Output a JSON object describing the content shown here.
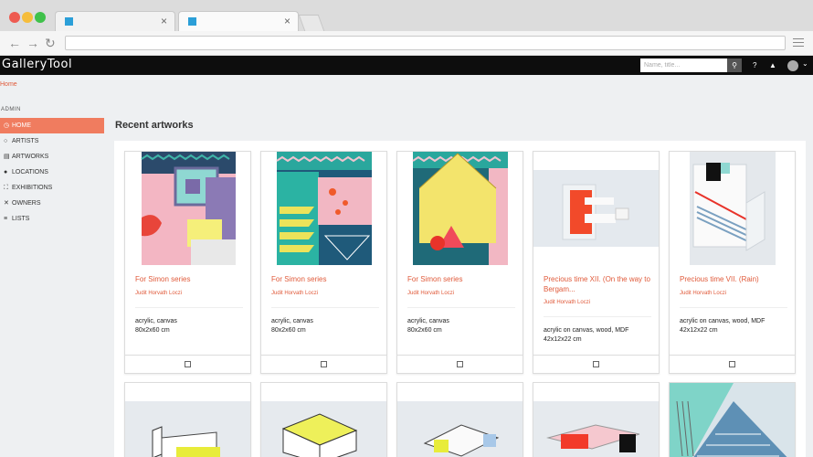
{
  "app": {
    "brand": "GalleryTool",
    "search_placeholder": "Name, title...",
    "search_icon": "search-icon"
  },
  "breadcrumb": {
    "home": "Home"
  },
  "sidebar": {
    "section": "ADMIN",
    "items": [
      {
        "label": "HOME",
        "icon": "clock-icon",
        "glyph": "◷",
        "active": true
      },
      {
        "label": "ARTISTS",
        "icon": "circle-icon",
        "glyph": "○",
        "active": false
      },
      {
        "label": "ARTWORKS",
        "icon": "images-icon",
        "glyph": "▤",
        "active": false
      },
      {
        "label": "LOCATIONS",
        "icon": "map-marker-icon",
        "glyph": "●",
        "active": false
      },
      {
        "label": "EXHIBITIONS",
        "icon": "expand-icon",
        "glyph": "⛶",
        "active": false
      },
      {
        "label": "OWNERS",
        "icon": "close-icon",
        "glyph": "✕",
        "active": false
      },
      {
        "label": "LISTS",
        "icon": "list-icon",
        "glyph": "≡",
        "active": false
      }
    ]
  },
  "main": {
    "title": "Recent artworks",
    "cards": [
      {
        "title": "For Simon series",
        "artist": "Judit Horvath Loczi",
        "medium": "acrylic, canvas",
        "size": "80x2x60 cm"
      },
      {
        "title": "For Simon series",
        "artist": "Judit Horvath Loczi",
        "medium": "acrylic, canvas",
        "size": "80x2x60 cm"
      },
      {
        "title": "For Simon series",
        "artist": "Judit Horvath Loczi",
        "medium": "acrylic, canvas",
        "size": "80x2x60 cm"
      },
      {
        "title": "Precious time XII. (On the way to Bergam...",
        "artist": "Judit Horvath Loczi",
        "medium": "acrylic on canvas, wood, MDF",
        "size": "42x12x22 cm"
      },
      {
        "title": "Precious time VII. (Rain)",
        "artist": "Judit Horvath Loczi",
        "medium": "acrylic on canvas, wood, MDF",
        "size": "42x12x22 cm"
      }
    ]
  }
}
